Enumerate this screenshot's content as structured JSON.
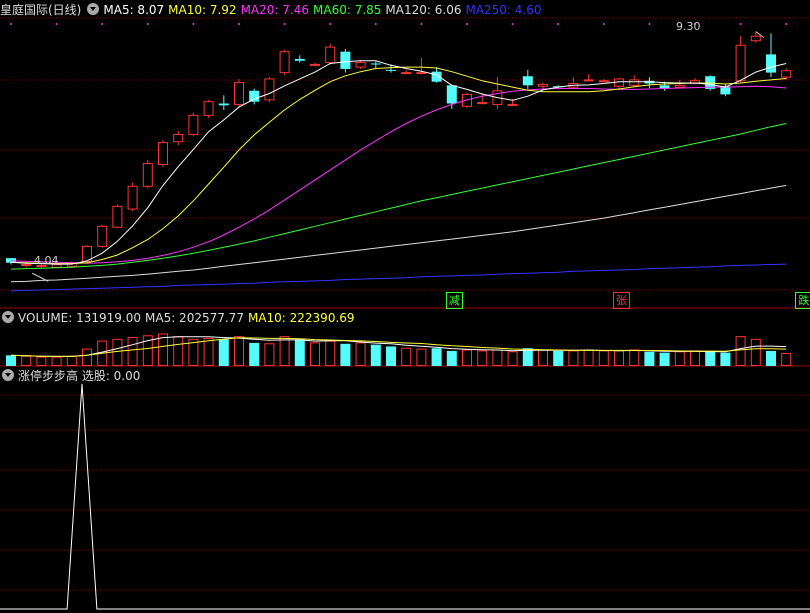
{
  "header": {
    "title": "皇庭国际(日线)",
    "ma": [
      {
        "label": "MA5: 8.07",
        "color": "#ffffff"
      },
      {
        "label": "MA10: 7.92",
        "color": "#ffff33"
      },
      {
        "label": "MA20: 7.46",
        "color": "#ff33ff"
      },
      {
        "label": "MA60: 7.85",
        "color": "#33ff33"
      },
      {
        "label": "MA120: 6.06",
        "color": "#dddddd"
      },
      {
        "label": "MA250: 4.60",
        "color": "#3333ff"
      }
    ]
  },
  "volume_header": {
    "vol": {
      "label": "VOLUME: 131919.00",
      "color": "#dddddd"
    },
    "ma5": {
      "label": "MA5: 202577.77",
      "color": "#dddddd"
    },
    "ma10": {
      "label": "MA10: 222390.69",
      "color": "#ffff33"
    }
  },
  "indicator_header": {
    "label": "涨停步步高 选股: 0.00",
    "color": "#dddddd"
  },
  "signals": [
    {
      "text": "减",
      "color": "#33ff33",
      "index": 29
    },
    {
      "text": "张",
      "color": "#ff3333",
      "index": 40
    },
    {
      "text": "跌",
      "color": "#33ff33",
      "index": 52
    }
  ],
  "price_labels": {
    "high": "9.30",
    "low": "4.04"
  },
  "colors": {
    "up": "#ff3333",
    "down": "#54fcfc",
    "bg": "#000000",
    "grid": "#7a0000"
  },
  "chart_data": {
    "type": "candlestick",
    "price_range": [
      3.4,
      9.6
    ],
    "ohlc": [
      [
        4.32,
        4.32,
        4.18,
        4.22
      ],
      [
        4.16,
        4.2,
        4.12,
        4.18
      ],
      [
        4.14,
        4.2,
        4.1,
        4.16
      ],
      [
        4.12,
        4.2,
        4.1,
        4.18
      ],
      [
        4.14,
        4.25,
        4.1,
        4.22
      ],
      [
        4.25,
        4.6,
        4.22,
        4.58
      ],
      [
        4.58,
        5.05,
        4.55,
        5.02
      ],
      [
        5.0,
        5.5,
        4.98,
        5.46
      ],
      [
        5.4,
        5.98,
        5.35,
        5.9
      ],
      [
        5.9,
        6.48,
        5.85,
        6.4
      ],
      [
        6.38,
        6.92,
        6.32,
        6.86
      ],
      [
        6.88,
        7.12,
        6.8,
        7.04
      ],
      [
        7.04,
        7.52,
        7.0,
        7.46
      ],
      [
        7.46,
        7.8,
        7.4,
        7.76
      ],
      [
        7.72,
        7.9,
        7.58,
        7.68
      ],
      [
        7.7,
        8.26,
        7.65,
        8.18
      ],
      [
        8.0,
        8.05,
        7.7,
        7.76
      ],
      [
        7.8,
        8.3,
        7.75,
        8.26
      ],
      [
        8.4,
        8.9,
        8.35,
        8.86
      ],
      [
        8.7,
        8.78,
        8.62,
        8.66
      ],
      [
        8.58,
        8.62,
        8.55,
        8.58
      ],
      [
        8.62,
        9.04,
        8.58,
        8.96
      ],
      [
        8.86,
        8.92,
        8.4,
        8.48
      ],
      [
        8.52,
        8.68,
        8.48,
        8.62
      ],
      [
        8.6,
        8.64,
        8.5,
        8.58
      ],
      [
        8.46,
        8.58,
        8.4,
        8.44
      ],
      [
        8.4,
        8.46,
        8.36,
        8.4
      ],
      [
        8.38,
        8.72,
        8.36,
        8.4
      ],
      [
        8.42,
        8.52,
        8.18,
        8.2
      ],
      [
        8.12,
        8.14,
        7.6,
        7.72
      ],
      [
        7.66,
        7.96,
        7.62,
        7.92
      ],
      [
        7.72,
        7.94,
        7.7,
        7.74
      ],
      [
        7.7,
        8.3,
        7.6,
        8.0
      ],
      [
        7.7,
        7.82,
        7.66,
        7.7
      ],
      [
        8.32,
        8.46,
        8.04,
        8.12
      ],
      [
        8.1,
        8.18,
        8.02,
        8.14
      ],
      [
        8.1,
        8.12,
        8.04,
        8.08
      ],
      [
        8.08,
        8.3,
        8.04,
        8.16
      ],
      [
        8.22,
        8.36,
        8.2,
        8.24
      ],
      [
        8.22,
        8.26,
        8.2,
        8.22
      ],
      [
        8.1,
        8.28,
        8.04,
        8.26
      ],
      [
        8.12,
        8.34,
        8.08,
        8.24
      ],
      [
        8.22,
        8.3,
        8.06,
        8.16
      ],
      [
        8.12,
        8.2,
        8.0,
        8.06
      ],
      [
        8.08,
        8.24,
        8.06,
        8.12
      ],
      [
        8.16,
        8.28,
        8.14,
        8.22
      ],
      [
        8.32,
        8.34,
        8.0,
        8.04
      ],
      [
        8.1,
        8.14,
        7.88,
        7.92
      ],
      [
        8.22,
        9.2,
        8.18,
        9.0
      ],
      [
        9.1,
        9.3,
        9.06,
        9.2
      ],
      [
        8.8,
        9.26,
        8.3,
        8.4
      ],
      [
        8.3,
        8.5,
        8.24,
        8.44
      ]
    ],
    "ma5": [
      4.23,
      4.21,
      4.2,
      4.19,
      4.19,
      4.26,
      4.43,
      4.69,
      5.03,
      5.43,
      5.92,
      6.33,
      6.71,
      7.1,
      7.36,
      7.64,
      7.82,
      7.94,
      8.11,
      8.26,
      8.41,
      8.6,
      8.64,
      8.66,
      8.66,
      8.56,
      8.49,
      8.43,
      8.35,
      8.12,
      8.03,
      7.93,
      7.85,
      7.79,
      7.88,
      8.02,
      8.08,
      8.12,
      8.13,
      8.16,
      8.2,
      8.2,
      8.2,
      8.18,
      8.17,
      8.17,
      8.14,
      8.08,
      8.23,
      8.41,
      8.52,
      8.6
    ],
    "ma10": [
      4.23,
      4.22,
      4.21,
      4.2,
      4.2,
      4.22,
      4.29,
      4.39,
      4.55,
      4.73,
      4.97,
      5.25,
      5.58,
      5.95,
      6.32,
      6.7,
      7.03,
      7.31,
      7.58,
      7.81,
      8.01,
      8.2,
      8.33,
      8.42,
      8.49,
      8.51,
      8.52,
      8.52,
      8.5,
      8.42,
      8.32,
      8.22,
      8.15,
      8.08,
      8.01,
      7.98,
      7.98,
      7.98,
      7.98,
      8.0,
      8.04,
      8.09,
      8.13,
      8.15,
      8.16,
      8.17,
      8.17,
      8.15,
      8.17,
      8.21,
      8.24,
      8.27
    ],
    "ma20": [
      4.26,
      4.25,
      4.24,
      4.23,
      4.22,
      4.21,
      4.22,
      4.24,
      4.27,
      4.32,
      4.38,
      4.46,
      4.56,
      4.68,
      4.83,
      5.0,
      5.18,
      5.38,
      5.6,
      5.82,
      6.04,
      6.26,
      6.48,
      6.7,
      6.9,
      7.1,
      7.28,
      7.44,
      7.58,
      7.7,
      7.8,
      7.88,
      7.94,
      7.99,
      8.02,
      8.04,
      8.05,
      8.05,
      8.05,
      8.04,
      8.03,
      8.03,
      8.04,
      8.05,
      8.06,
      8.07,
      8.08,
      8.08,
      8.09,
      8.1,
      8.09,
      8.06
    ],
    "ma60": [
      4.08,
      4.09,
      4.1,
      4.11,
      4.12,
      4.14,
      4.16,
      4.19,
      4.23,
      4.27,
      4.32,
      4.37,
      4.43,
      4.49,
      4.56,
      4.63,
      4.7,
      4.78,
      4.86,
      4.94,
      5.02,
      5.1,
      5.18,
      5.26,
      5.34,
      5.42,
      5.5,
      5.58,
      5.65,
      5.72,
      5.79,
      5.86,
      5.93,
      6.0,
      6.07,
      6.14,
      6.21,
      6.28,
      6.35,
      6.42,
      6.49,
      6.56,
      6.63,
      6.7,
      6.77,
      6.84,
      6.91,
      6.98,
      7.05,
      7.13,
      7.21,
      7.28
    ],
    "ma120": [
      3.8,
      3.81,
      3.83,
      3.84,
      3.86,
      3.88,
      3.9,
      3.92,
      3.94,
      3.97,
      4.0,
      4.03,
      4.06,
      4.1,
      4.14,
      4.18,
      4.22,
      4.26,
      4.3,
      4.34,
      4.38,
      4.42,
      4.46,
      4.5,
      4.54,
      4.58,
      4.62,
      4.66,
      4.7,
      4.74,
      4.78,
      4.82,
      4.86,
      4.9,
      4.95,
      5.0,
      5.05,
      5.1,
      5.15,
      5.2,
      5.26,
      5.32,
      5.38,
      5.44,
      5.5,
      5.56,
      5.62,
      5.68,
      5.74,
      5.8,
      5.86,
      5.92
    ],
    "ma250": [
      3.6,
      3.61,
      3.62,
      3.63,
      3.64,
      3.65,
      3.66,
      3.67,
      3.68,
      3.69,
      3.7,
      3.72,
      3.73,
      3.74,
      3.75,
      3.76,
      3.77,
      3.79,
      3.8,
      3.81,
      3.82,
      3.83,
      3.85,
      3.86,
      3.87,
      3.88,
      3.89,
      3.91,
      3.92,
      3.93,
      3.94,
      3.95,
      3.97,
      3.98,
      3.99,
      4.0,
      4.01,
      4.03,
      4.04,
      4.05,
      4.06,
      4.07,
      4.09,
      4.1,
      4.11,
      4.12,
      4.13,
      4.15,
      4.16,
      4.17,
      4.18,
      4.19
    ],
    "volume_range": [
      0,
      450000
    ],
    "volume": [
      120000,
      110000,
      100000,
      100000,
      110000,
      190000,
      280000,
      300000,
      320000,
      340000,
      360000,
      330000,
      300000,
      310000,
      300000,
      330000,
      260000,
      250000,
      330000,
      300000,
      260000,
      280000,
      250000,
      260000,
      240000,
      220000,
      200000,
      190000,
      200000,
      170000,
      180000,
      170000,
      180000,
      160000,
      200000,
      180000,
      170000,
      170000,
      180000,
      170000,
      170000,
      180000,
      160000,
      150000,
      160000,
      170000,
      170000,
      150000,
      330000,
      300000,
      170000,
      140000
    ],
    "volume_ma5": [
      null,
      null,
      null,
      null,
      null,
      null,
      null,
      null,
      null,
      null,
      null,
      null,
      null,
      null,
      null,
      null,
      null,
      null,
      null,
      null,
      null,
      null,
      null,
      null,
      null,
      null,
      null,
      null,
      null,
      null,
      null,
      null,
      null,
      null,
      null,
      null,
      null,
      null,
      null,
      null,
      null,
      null,
      null,
      null,
      null,
      null,
      null,
      null,
      null,
      null,
      null,
      202577.77
    ],
    "volume_ma10": [
      null,
      null,
      null,
      null,
      null,
      null,
      null,
      null,
      null,
      null,
      null,
      null,
      null,
      null,
      null,
      null,
      null,
      null,
      null,
      null,
      null,
      null,
      null,
      null,
      null,
      null,
      null,
      null,
      null,
      null,
      null,
      null,
      null,
      null,
      null,
      null,
      null,
      null,
      null,
      null,
      null,
      null,
      null,
      null,
      null,
      null,
      null,
      null,
      null,
      null,
      null,
      222390.69
    ],
    "indicator": [
      0,
      0,
      0,
      0,
      0,
      1,
      0,
      0,
      0,
      0,
      0,
      0,
      0,
      0,
      0,
      0,
      0,
      0,
      0,
      0,
      0,
      0,
      0,
      0,
      0,
      0,
      0,
      0,
      0,
      0,
      0,
      0,
      0,
      0,
      0,
      0,
      0,
      0,
      0,
      0,
      0,
      0,
      0,
      0,
      0,
      0,
      0,
      0,
      0,
      0,
      0,
      0
    ],
    "indicator_range": [
      0,
      1
    ]
  }
}
